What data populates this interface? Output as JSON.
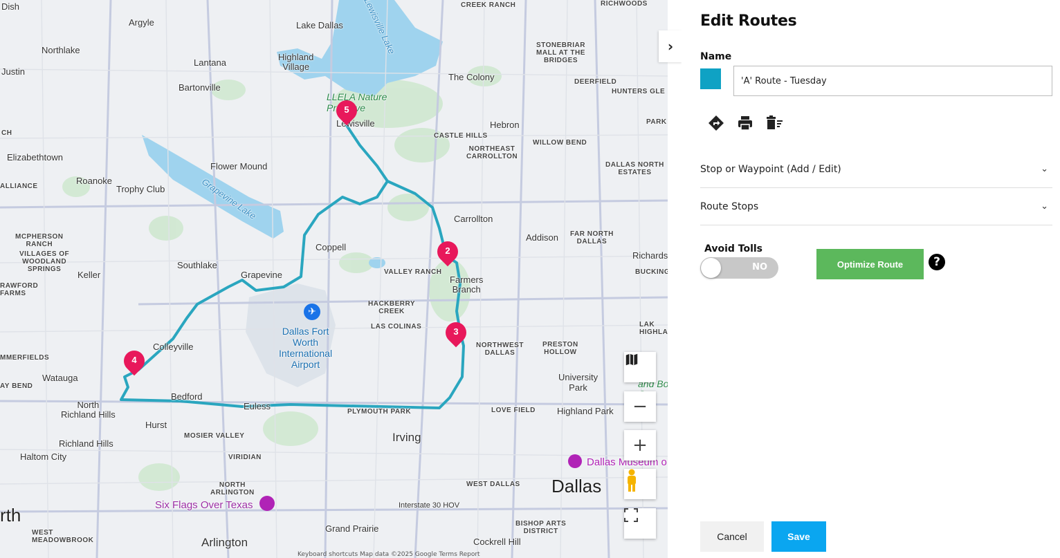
{
  "map": {
    "labels": {
      "dish": "Dish",
      "argyle": "Argyle",
      "lake_dallas": "Lake Dallas",
      "creek_ranch": "CREEK RANCH",
      "richwoods": "RICHWOODS",
      "northlake": "Northlake",
      "lewisville_lake": "Lewisville Lake",
      "highland_village": "Highland\nVillage",
      "stonebriar": "STONEBRIAR\nMALL AT THE\nBRIDGES",
      "justin": "Justin",
      "lantana": "Lantana",
      "bartonville": "Bartonville",
      "the_colony": "The Colony",
      "deerfield": "DEERFIELD",
      "hunters_glen": "HUNTERS GLE",
      "llela": "LLELA Nature\nPreserve",
      "lewisville": "Lewisville",
      "hebron": "Hebron",
      "park": "PARK",
      "ch": "CH",
      "castle_hills": "CASTLE HILLS",
      "willow_bend": "WILLOW BEND",
      "ne_carrollton": "NORTHEAST\nCARROLLTON",
      "elizabethtown": "Elizabethtown",
      "flower_mound": "Flower Mound",
      "dallas_north_estates": "DALLAS NORTH\nESTATES",
      "alliance": "ALLIANCE",
      "roanoke": "Roanoke",
      "trophy_club": "Trophy Club",
      "grapevine_lake": "Grapevine Lake",
      "carrollton": "Carrollton",
      "mcpherson": "MCPHERSON\nRANCH",
      "villages_woodland": "VILLAGES OF\nWOODLAND\nSPRINGS",
      "coppell": "Coppell",
      "addison": "Addison",
      "far_north_dallas": "FAR NORTH\nDALLAS",
      "southlake": "Southlake",
      "richards": "Richards",
      "keller": "Keller",
      "grapevine": "Grapevine",
      "valley_ranch": "VALLEY RANCH",
      "farmers_branch": "Farmers\nBranch",
      "bucking": "BUCKING",
      "rawford": "RAWFORD\nFARMS",
      "hackberry": "HACKBERRY\nCREEK",
      "las_colinas": "LAS COLINAS",
      "lake_highla": "LAK\nHIGHLA",
      "dfw": "Dallas Fort\nWorth\nInternational\nAirport",
      "nw_dallas": "NORTHWEST\nDALLAS",
      "preston_hollow": "PRESTON\nHOLLOW",
      "colleyville": "Colleyville",
      "mmerfields": "MMERFIELDS",
      "watauga": "Watauga",
      "university_park": "University\nPark",
      "ay_bend": "AY BEND",
      "north_richland": "North\nRichland Hills",
      "bedford": "Bedford",
      "euless": "Euless",
      "plymouth_park": "PLYMOUTH PARK",
      "love_field": "LOVE FIELD",
      "highland_park": "Highland Park",
      "hurst": "Hurst",
      "irving": "Irving",
      "mosier_valley": "MOSIER VALLEY",
      "richland_hills": "Richland Hills",
      "dallas_museum": "Dallas Museum o",
      "haltom": "Haltom City",
      "viridian": "VIRIDIAN",
      "north_arlington": "NORTH\nARLINGTON",
      "west_dallas": "WEST DALLAS",
      "dallas": "Dallas",
      "rth": "rth",
      "six_flags": "Six Flags Over Texas",
      "interstate30": "Interstate 30 HOV",
      "west_meadowbrook": "WEST\nMEADOWBROOK",
      "grand_prairie": "Grand Prairie",
      "bishop_arts": "BISHOP ARTS\nDISTRICT",
      "arlington": "Arlington",
      "cockrell_hill": "Cockrell Hill",
      "garden_fragment": "e\nrboi\nand Bo\nGa"
    },
    "pins": [
      "5",
      "2",
      "3",
      "4"
    ],
    "footer": "Keyboard shortcuts   Map data ©2025 Google   Terms   Report",
    "route_color": "#2aa6bf"
  },
  "panel": {
    "title": "Edit Routes",
    "name_label": "Name",
    "route_color": "#0fa2c4",
    "route_name": "'A' Route - Tuesday",
    "accordions": [
      {
        "label": "Stop or Waypoint (Add / Edit)"
      },
      {
        "label": "Route Stops"
      }
    ],
    "avoid_tolls_label": "Avoid Tolls",
    "toggle_state": "NO",
    "optimize_label": "Optimize Route",
    "help_glyph": "?",
    "cancel_label": "Cancel",
    "save_label": "Save"
  }
}
